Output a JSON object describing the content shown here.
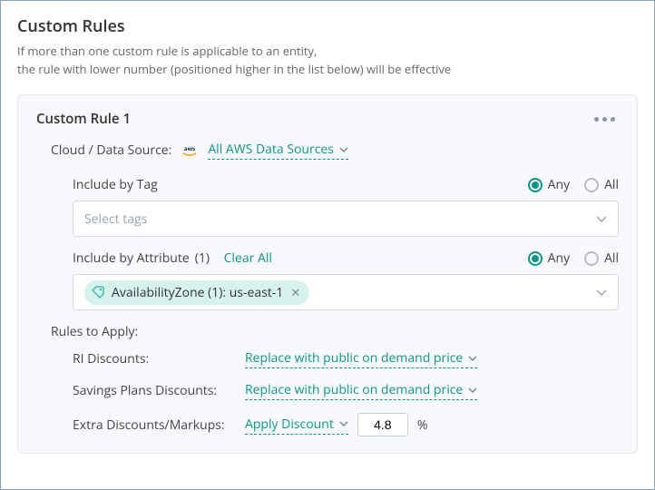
{
  "header": {
    "title": "Custom Rules",
    "desc_line1": "If more than one custom rule is applicable to an entity,",
    "desc_line2": "the rule with lower number (positioned higher in the list below) will be effective"
  },
  "card": {
    "title": "Custom Rule 1",
    "cloud_label": "Cloud / Data Source:",
    "cloud_value": "All AWS Data Sources",
    "include_tag": {
      "label": "Include by Tag",
      "placeholder": "Select tags",
      "radio_any": "Any",
      "radio_all": "All",
      "selected": "any"
    },
    "include_attr": {
      "label_prefix": "Include by Attribute",
      "count_suffix": "(1)",
      "clear": "Clear All",
      "radio_any": "Any",
      "radio_all": "All",
      "selected": "any",
      "chip_text": "AvailabilityZone (1): us-east-1"
    },
    "rules_title": "Rules to Apply:",
    "rules": {
      "ri_label": "RI Discounts:",
      "ri_value": "Replace with public on demand price",
      "sp_label": "Savings Plans Discounts:",
      "sp_value": "Replace with public on demand price",
      "extra_label": "Extra Discounts/Markups:",
      "extra_type": "Apply Discount",
      "extra_amount": "4.8",
      "pct": "%"
    }
  }
}
